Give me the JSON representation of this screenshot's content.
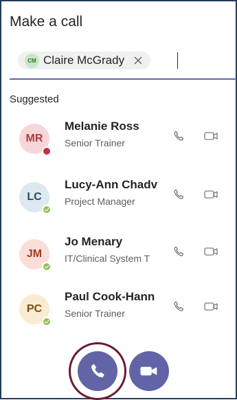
{
  "header": {
    "title": "Make a call"
  },
  "recipient": {
    "initials": "CM",
    "name": "Claire McGrady",
    "remove_icon": "close-icon"
  },
  "suggested": {
    "label": "Suggested",
    "contacts": [
      {
        "initials": "MR",
        "name": "Melanie Ross",
        "title": "Senior Trainer",
        "avatar_bg": "#f6d7d9",
        "avatar_fg": "#b0383e",
        "presence": "busy"
      },
      {
        "initials": "LC",
        "name": "Lucy-Ann Chadv",
        "title": "Project Manager",
        "avatar_bg": "#dde9ef",
        "avatar_fg": "#2a4a5c",
        "presence": "available"
      },
      {
        "initials": "JM",
        "name": "Jo Menary",
        "title": "IT/Clinical System T",
        "avatar_bg": "#fadfd8",
        "avatar_fg": "#a33a24",
        "presence": "available"
      },
      {
        "initials": "PC",
        "name": "Paul Cook-Hann",
        "title": "Senior Trainer",
        "avatar_bg": "#faebd3",
        "avatar_fg": "#7a4e12",
        "presence": "available"
      }
    ]
  },
  "actions": {
    "audio_icon": "phone-icon",
    "video_icon": "video-camera-icon"
  },
  "colors": {
    "accent": "#6264a7",
    "highlight": "#6c1838",
    "frame": "#243c5a"
  }
}
